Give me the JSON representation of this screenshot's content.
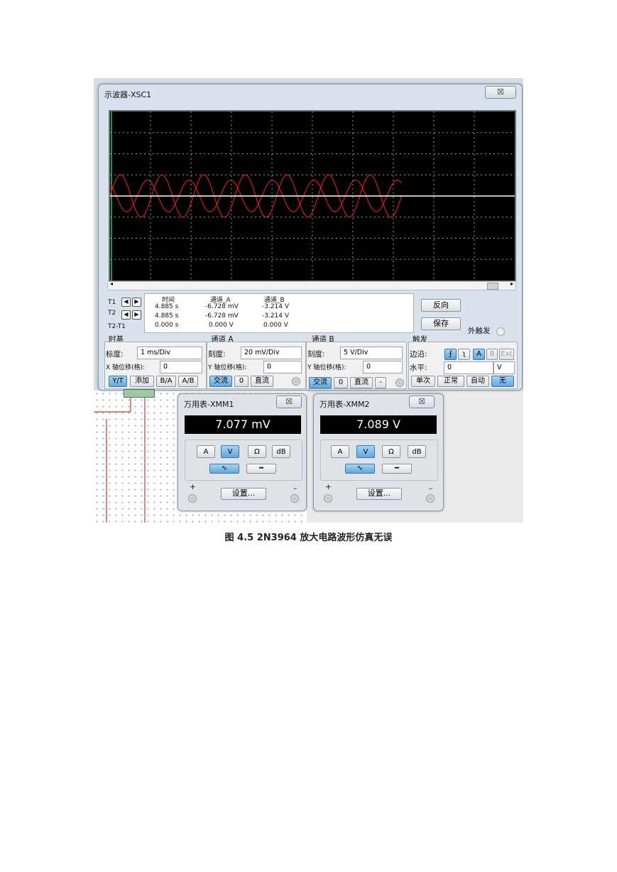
{
  "oscilloscope": {
    "title": "示波器-XSC1",
    "close": "☒",
    "cursor_table": {
      "headers": [
        "时间",
        "通道_A",
        "通道_B"
      ],
      "rows": [
        {
          "label": "T1",
          "time": "4.885 s",
          "a": "-6.728 mV",
          "b": "-3.214 V"
        },
        {
          "label": "T2",
          "time": "4.885 s",
          "a": "-6.728 mV",
          "b": "-3.214 V"
        },
        {
          "label": "T2-T1",
          "time": "0.000 s",
          "a": "0.000 V",
          "b": "0.000 V"
        }
      ]
    },
    "reverse_button": "反向",
    "save_button": "保存",
    "ext_trigger": "外触发",
    "timebase": {
      "title": "时基",
      "scale_label": "标度:",
      "scale": "1 ms/Div",
      "xpos_label": "X 轴位移(格):",
      "xpos": "0",
      "yt": "Y/T",
      "add": "添加",
      "ba": "B/A",
      "ab": "A/B"
    },
    "channel_a": {
      "title": "通道 A",
      "scale_label": "刻度:",
      "scale": "20 mV/Div",
      "ypos_label": "Y 轴位移(格):",
      "ypos": "0",
      "ac": "交流",
      "zero": "0",
      "dc": "直流"
    },
    "channel_b": {
      "title": "通道 B",
      "scale_label": "刻度:",
      "scale": "5  V/Div",
      "ypos_label": "Y 轴位移(格):",
      "ypos": "0",
      "ac": "交流",
      "zero": "0",
      "dc": "直流",
      "minus": "-"
    },
    "trigger": {
      "title": "触发",
      "edge_label": "边沿:",
      "level_label": "水平:",
      "level": "0",
      "unit": "V",
      "a": "A",
      "b": "B",
      "ext": "Ext",
      "single": "单次",
      "normal": "正常",
      "auto": "自动",
      "none": "无"
    }
  },
  "chart_data": {
    "type": "line",
    "title": "",
    "xlabel": "",
    "ylabel": "",
    "grid": true,
    "divisions": {
      "x": 10,
      "y": 8
    },
    "series": [
      {
        "color": "#d42020",
        "amplitude_div": 1.0,
        "cycles": 7,
        "phase": 0.0
      },
      {
        "color": "#d42020",
        "amplitude_div": 0.75,
        "cycles": 7,
        "phase": 0.35
      },
      {
        "color": "#ffffff",
        "amplitude_div": 0.0,
        "cycles": 0,
        "phase": 0.0
      }
    ]
  },
  "meter1": {
    "title": "万用表-XMM1",
    "close": "☒",
    "reading": "7.077 mV",
    "a": "A",
    "v": "V",
    "ohm": "Ω",
    "db": "dB",
    "settings": "设置...",
    "plus": "+",
    "minus": "–"
  },
  "meter2": {
    "title": "万用表-XMM2",
    "close": "☒",
    "reading": "7.089 V",
    "a": "A",
    "v": "V",
    "ohm": "Ω",
    "db": "dB",
    "settings": "设置...",
    "plus": "+",
    "minus": "–"
  },
  "caption": "图 4.5 2N3964 放大电路波形仿真无误"
}
